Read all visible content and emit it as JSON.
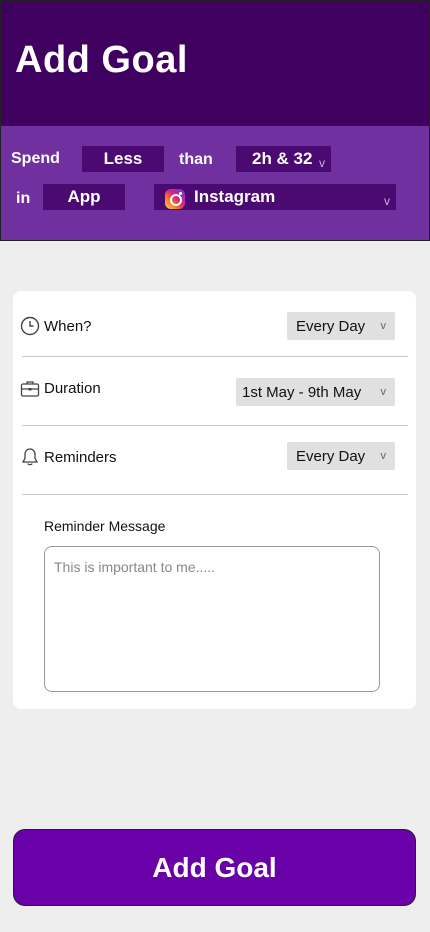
{
  "header": {
    "title": "Add Goal"
  },
  "goal": {
    "spend_label": "Spend",
    "comparison": "Less",
    "than_label": "than",
    "duration_value": "2h & 32",
    "in_label": "in",
    "target_type": "App",
    "app_name": "Instagram",
    "app_icon": "instagram-icon"
  },
  "settings": {
    "when": {
      "label": "When?",
      "value": "Every Day",
      "icon": "clock-icon"
    },
    "duration": {
      "label": "Duration",
      "value": "1st May - 9th May",
      "icon": "briefcase-icon"
    },
    "reminders": {
      "label": "Reminders",
      "value": "Every Day",
      "icon": "bell-icon"
    },
    "message": {
      "label": "Reminder Message",
      "placeholder": "This is important to me....."
    }
  },
  "chevron": "v",
  "actions": {
    "add_goal_label": "Add Goal"
  },
  "colors": {
    "header_bg": "#3f005f",
    "goal_bar_bg": "#7030a0",
    "pill_bg": "#4a0a72",
    "button_bg": "#6a00a8",
    "page_bg": "#eeeeee"
  }
}
